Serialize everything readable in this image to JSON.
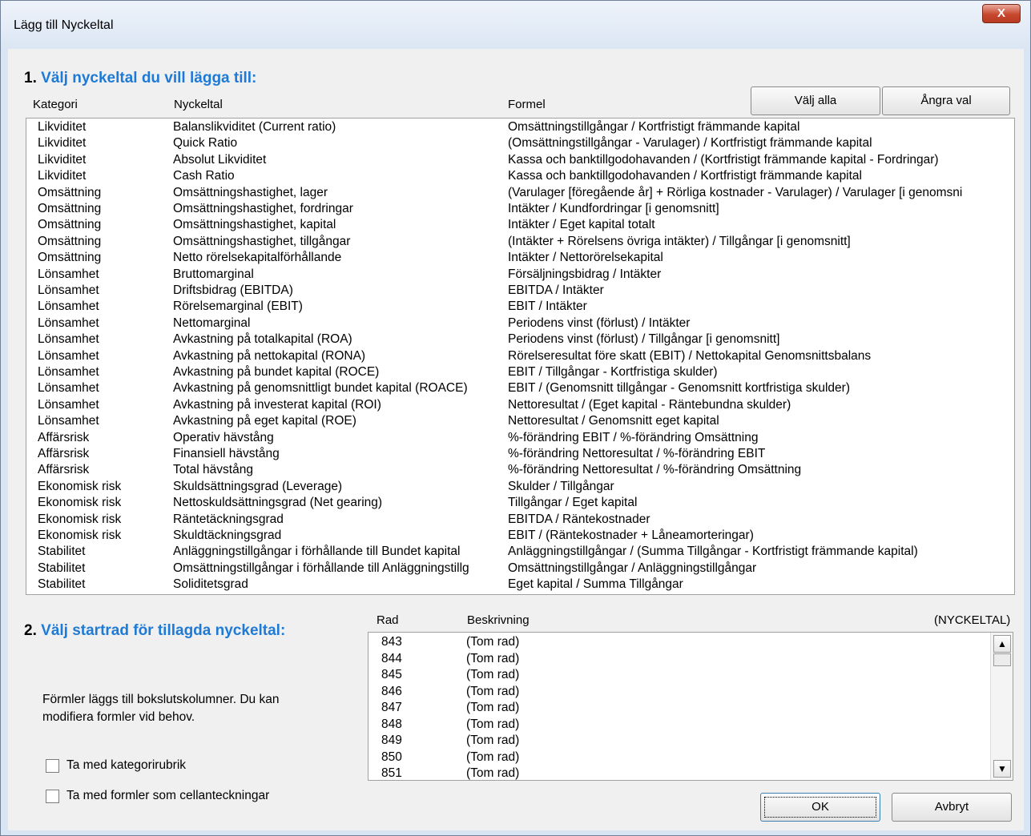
{
  "window": {
    "title": "Lägg till Nyckeltal",
    "close_glyph": "X"
  },
  "step1": {
    "number": "1.",
    "title": "Välj nyckeltal du vill lägga till:",
    "headers": {
      "category": "Kategori",
      "ratio": "Nyckeltal",
      "formula": "Formel"
    },
    "select_all_label": "Välj alla",
    "undo_label": "Ångra val",
    "rows": [
      {
        "category": "Likviditet",
        "ratio": "Balanslikviditet (Current ratio)",
        "formula": "Omsättningstillgångar / Kortfristigt främmande kapital"
      },
      {
        "category": "Likviditet",
        "ratio": "Quick Ratio",
        "formula": "(Omsättningstillgångar - Varulager) / Kortfristigt främmande kapital"
      },
      {
        "category": "Likviditet",
        "ratio": "Absolut Likviditet",
        "formula": "Kassa och banktillgodohavanden / (Kortfristigt främmande kapital - Fordringar)"
      },
      {
        "category": "Likviditet",
        "ratio": "Cash Ratio",
        "formula": "Kassa och banktillgodohavanden / Kortfristigt främmande kapital"
      },
      {
        "category": "Omsättning",
        "ratio": "Omsättningshastighet, lager",
        "formula": "(Varulager [föregående år] + Rörliga kostnader - Varulager) / Varulager [i genomsni"
      },
      {
        "category": "Omsättning",
        "ratio": "Omsättningshastighet, fordringar",
        "formula": "Intäkter / Kundfordringar [i genomsnitt]"
      },
      {
        "category": "Omsättning",
        "ratio": "Omsättningshastighet, kapital",
        "formula": "Intäkter / Eget kapital totalt"
      },
      {
        "category": "Omsättning",
        "ratio": "Omsättningshastighet, tillgångar",
        "formula": "(Intäkter + Rörelsens övriga intäkter) / Tillgångar [i genomsnitt]"
      },
      {
        "category": "Omsättning",
        "ratio": "Netto rörelsekapitalförhållande",
        "formula": "Intäkter / Nettorörelsekapital"
      },
      {
        "category": "Lönsamhet",
        "ratio": "Bruttomarginal",
        "formula": "Försäljningsbidrag / Intäkter"
      },
      {
        "category": "Lönsamhet",
        "ratio": "Driftsbidrag (EBITDA)",
        "formula": "EBITDA / Intäkter"
      },
      {
        "category": "Lönsamhet",
        "ratio": "Rörelsemarginal (EBIT)",
        "formula": "EBIT / Intäkter"
      },
      {
        "category": "Lönsamhet",
        "ratio": "Nettomarginal",
        "formula": "Periodens vinst (förlust) / Intäkter"
      },
      {
        "category": "Lönsamhet",
        "ratio": "Avkastning på totalkapital (ROA)",
        "formula": "Periodens vinst (förlust) / Tillgångar [i genomsnitt]"
      },
      {
        "category": "Lönsamhet",
        "ratio": "Avkastning på nettokapital (RONA)",
        "formula": "Rörelseresultat före skatt (EBIT) / Nettokapital Genomsnittsbalans"
      },
      {
        "category": "Lönsamhet",
        "ratio": "Avkastning på bundet kapital (ROCE)",
        "formula": "EBIT / Tillgångar - Kortfristiga skulder)"
      },
      {
        "category": "Lönsamhet",
        "ratio": "Avkastning på genomsnittligt bundet kapital (ROACE)",
        "formula": "EBIT / (Genomsnitt tillgångar - Genomsnitt kortfristiga skulder)"
      },
      {
        "category": "Lönsamhet",
        "ratio": "Avkastning på investerat kapital (ROI)",
        "formula": "Nettoresultat / (Eget kapital - Räntebundna skulder)"
      },
      {
        "category": "Lönsamhet",
        "ratio": "Avkastning på eget kapital (ROE)",
        "formula": "Nettoresultat / Genomsnitt eget kapital"
      },
      {
        "category": "Affärsrisk",
        "ratio": "Operativ hävstång",
        "formula": "%-förändring EBIT / %-förändring Omsättning"
      },
      {
        "category": "Affärsrisk",
        "ratio": "Finansiell hävstång",
        "formula": "%-förändring Nettoresultat / %-förändring EBIT"
      },
      {
        "category": "Affärsrisk",
        "ratio": "Total hävstång",
        "formula": "%-förändring Nettoresultat / %-förändring Omsättning"
      },
      {
        "category": "Ekonomisk risk",
        "ratio": "Skuldsättningsgrad (Leverage)",
        "formula": "Skulder / Tillgångar"
      },
      {
        "category": "Ekonomisk risk",
        "ratio": "Nettoskuldsättningsgrad (Net gearing)",
        "formula": "Tillgångar / Eget kapital"
      },
      {
        "category": "Ekonomisk risk",
        "ratio": "Räntetäckningsgrad",
        "formula": "EBITDA / Räntekostnader"
      },
      {
        "category": "Ekonomisk risk",
        "ratio": "Skuldtäckningsgrad",
        "formula": "EBIT / (Räntekostnader + Låneamorteringar)"
      },
      {
        "category": "Stabilitet",
        "ratio": "Anläggningstillgångar i förhållande till Bundet kapital",
        "formula": "Anläggningstillgångar / (Summa Tillgångar - Kortfristigt främmande kapital)"
      },
      {
        "category": "Stabilitet",
        "ratio": "Omsättningstillgångar i förhållande till Anläggningstillg",
        "formula": "Omsättningstillgångar / Anläggningstillgångar"
      },
      {
        "category": "Stabilitet",
        "ratio": "Soliditetsgrad",
        "formula": "Eget kapital / Summa Tillgångar"
      }
    ]
  },
  "step2": {
    "number": "2.",
    "title": "Välj startrad för tillagda nyckeltal:",
    "headers": {
      "row": "Rad",
      "description": "Beskrivning",
      "sheet": "(NYCKELTAL)"
    },
    "rows": [
      {
        "row": "843",
        "description": "(Tom rad)"
      },
      {
        "row": "844",
        "description": "(Tom rad)"
      },
      {
        "row": "845",
        "description": "(Tom rad)"
      },
      {
        "row": "846",
        "description": "(Tom rad)"
      },
      {
        "row": "847",
        "description": "(Tom rad)"
      },
      {
        "row": "848",
        "description": "(Tom rad)"
      },
      {
        "row": "849",
        "description": "(Tom rad)"
      },
      {
        "row": "850",
        "description": "(Tom rad)"
      },
      {
        "row": "851",
        "description": "(Tom rad)"
      }
    ],
    "info_line1": "Förmler läggs till bokslutskolumner. Du kan",
    "info_line2": "modifiera formler vid behov.",
    "checkbox_category": "Ta med kategorirubrik",
    "checkbox_formulas": "Ta med formler som cellanteckningar"
  },
  "footer": {
    "ok_label": "OK",
    "cancel_label": "Avbryt"
  }
}
